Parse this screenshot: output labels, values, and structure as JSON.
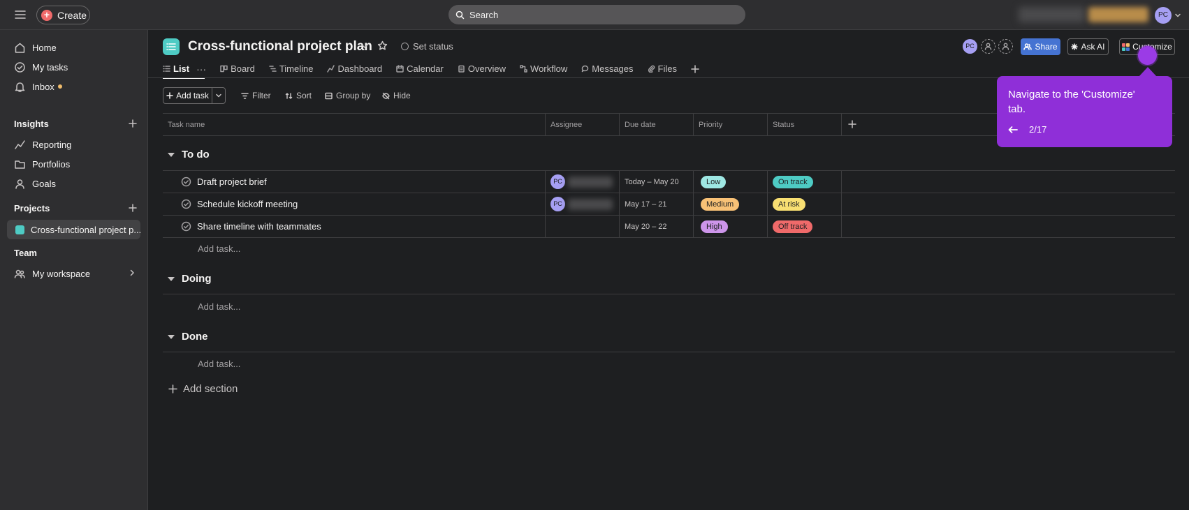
{
  "topbar": {
    "create_label": "Create",
    "search_placeholder": "Search",
    "avatar_initials": "PC"
  },
  "sidebar": {
    "items": [
      {
        "label": "Home",
        "icon": "home-icon"
      },
      {
        "label": "My tasks",
        "icon": "check-circle-icon"
      },
      {
        "label": "Inbox",
        "icon": "bell-icon"
      }
    ],
    "insights_heading": "Insights",
    "insights_items": [
      {
        "label": "Reporting",
        "icon": "line-chart-icon"
      },
      {
        "label": "Portfolios",
        "icon": "folder-icon"
      },
      {
        "label": "Goals",
        "icon": "person-icon"
      }
    ],
    "projects_heading": "Projects",
    "active_project": "Cross-functional project p...",
    "team_heading": "Team",
    "workspace_label": "My workspace"
  },
  "project": {
    "title": "Cross-functional project plan",
    "set_status": "Set status",
    "avatar_initials": "PC",
    "share_label": "Share",
    "ask_ai_label": "Ask AI",
    "customize_label": "Customize"
  },
  "tabs": [
    {
      "label": "List",
      "icon": "list-icon"
    },
    {
      "label": "Board",
      "icon": "board-icon"
    },
    {
      "label": "Timeline",
      "icon": "timeline-icon"
    },
    {
      "label": "Dashboard",
      "icon": "dashboard-icon"
    },
    {
      "label": "Calendar",
      "icon": "calendar-icon"
    },
    {
      "label": "Overview",
      "icon": "overview-icon"
    },
    {
      "label": "Workflow",
      "icon": "workflow-icon"
    },
    {
      "label": "Messages",
      "icon": "message-icon"
    },
    {
      "label": "Files",
      "icon": "paperclip-icon"
    }
  ],
  "tab_more": "···",
  "toolbar": {
    "add_task": "Add task",
    "filter": "Filter",
    "sort": "Sort",
    "group_by": "Group by",
    "hide": "Hide"
  },
  "columns": [
    "Task name",
    "Assignee",
    "Due date",
    "Priority",
    "Status"
  ],
  "sections": [
    {
      "name": "To do",
      "tasks": [
        {
          "name": "Draft project brief",
          "assignee_initials": "PC",
          "due": "Today – May 20",
          "priority": "Low",
          "status": "On track"
        },
        {
          "name": "Schedule kickoff meeting",
          "assignee_initials": "PC",
          "due": "May 17 – 21",
          "priority": "Medium",
          "status": "At risk"
        },
        {
          "name": "Share timeline with teammates",
          "assignee_initials": "",
          "due": "May 20 – 22",
          "priority": "High",
          "status": "Off track"
        }
      ]
    },
    {
      "name": "Doing",
      "tasks": []
    },
    {
      "name": "Done",
      "tasks": []
    }
  ],
  "add_task_link": "Add task...",
  "add_section": "Add section",
  "tooltip": {
    "text": "Navigate to the 'Customize' tab.",
    "step": "2/17"
  },
  "colors": {
    "accent": "#8f2fd8",
    "share": "#4573d2",
    "priority_low": "#9ee7e3",
    "priority_medium": "#f8c176",
    "priority_high": "#cd95ea",
    "status_on_track": "#4ecbc4",
    "status_at_risk": "#f8df72",
    "status_off_track": "#f06a6a"
  }
}
